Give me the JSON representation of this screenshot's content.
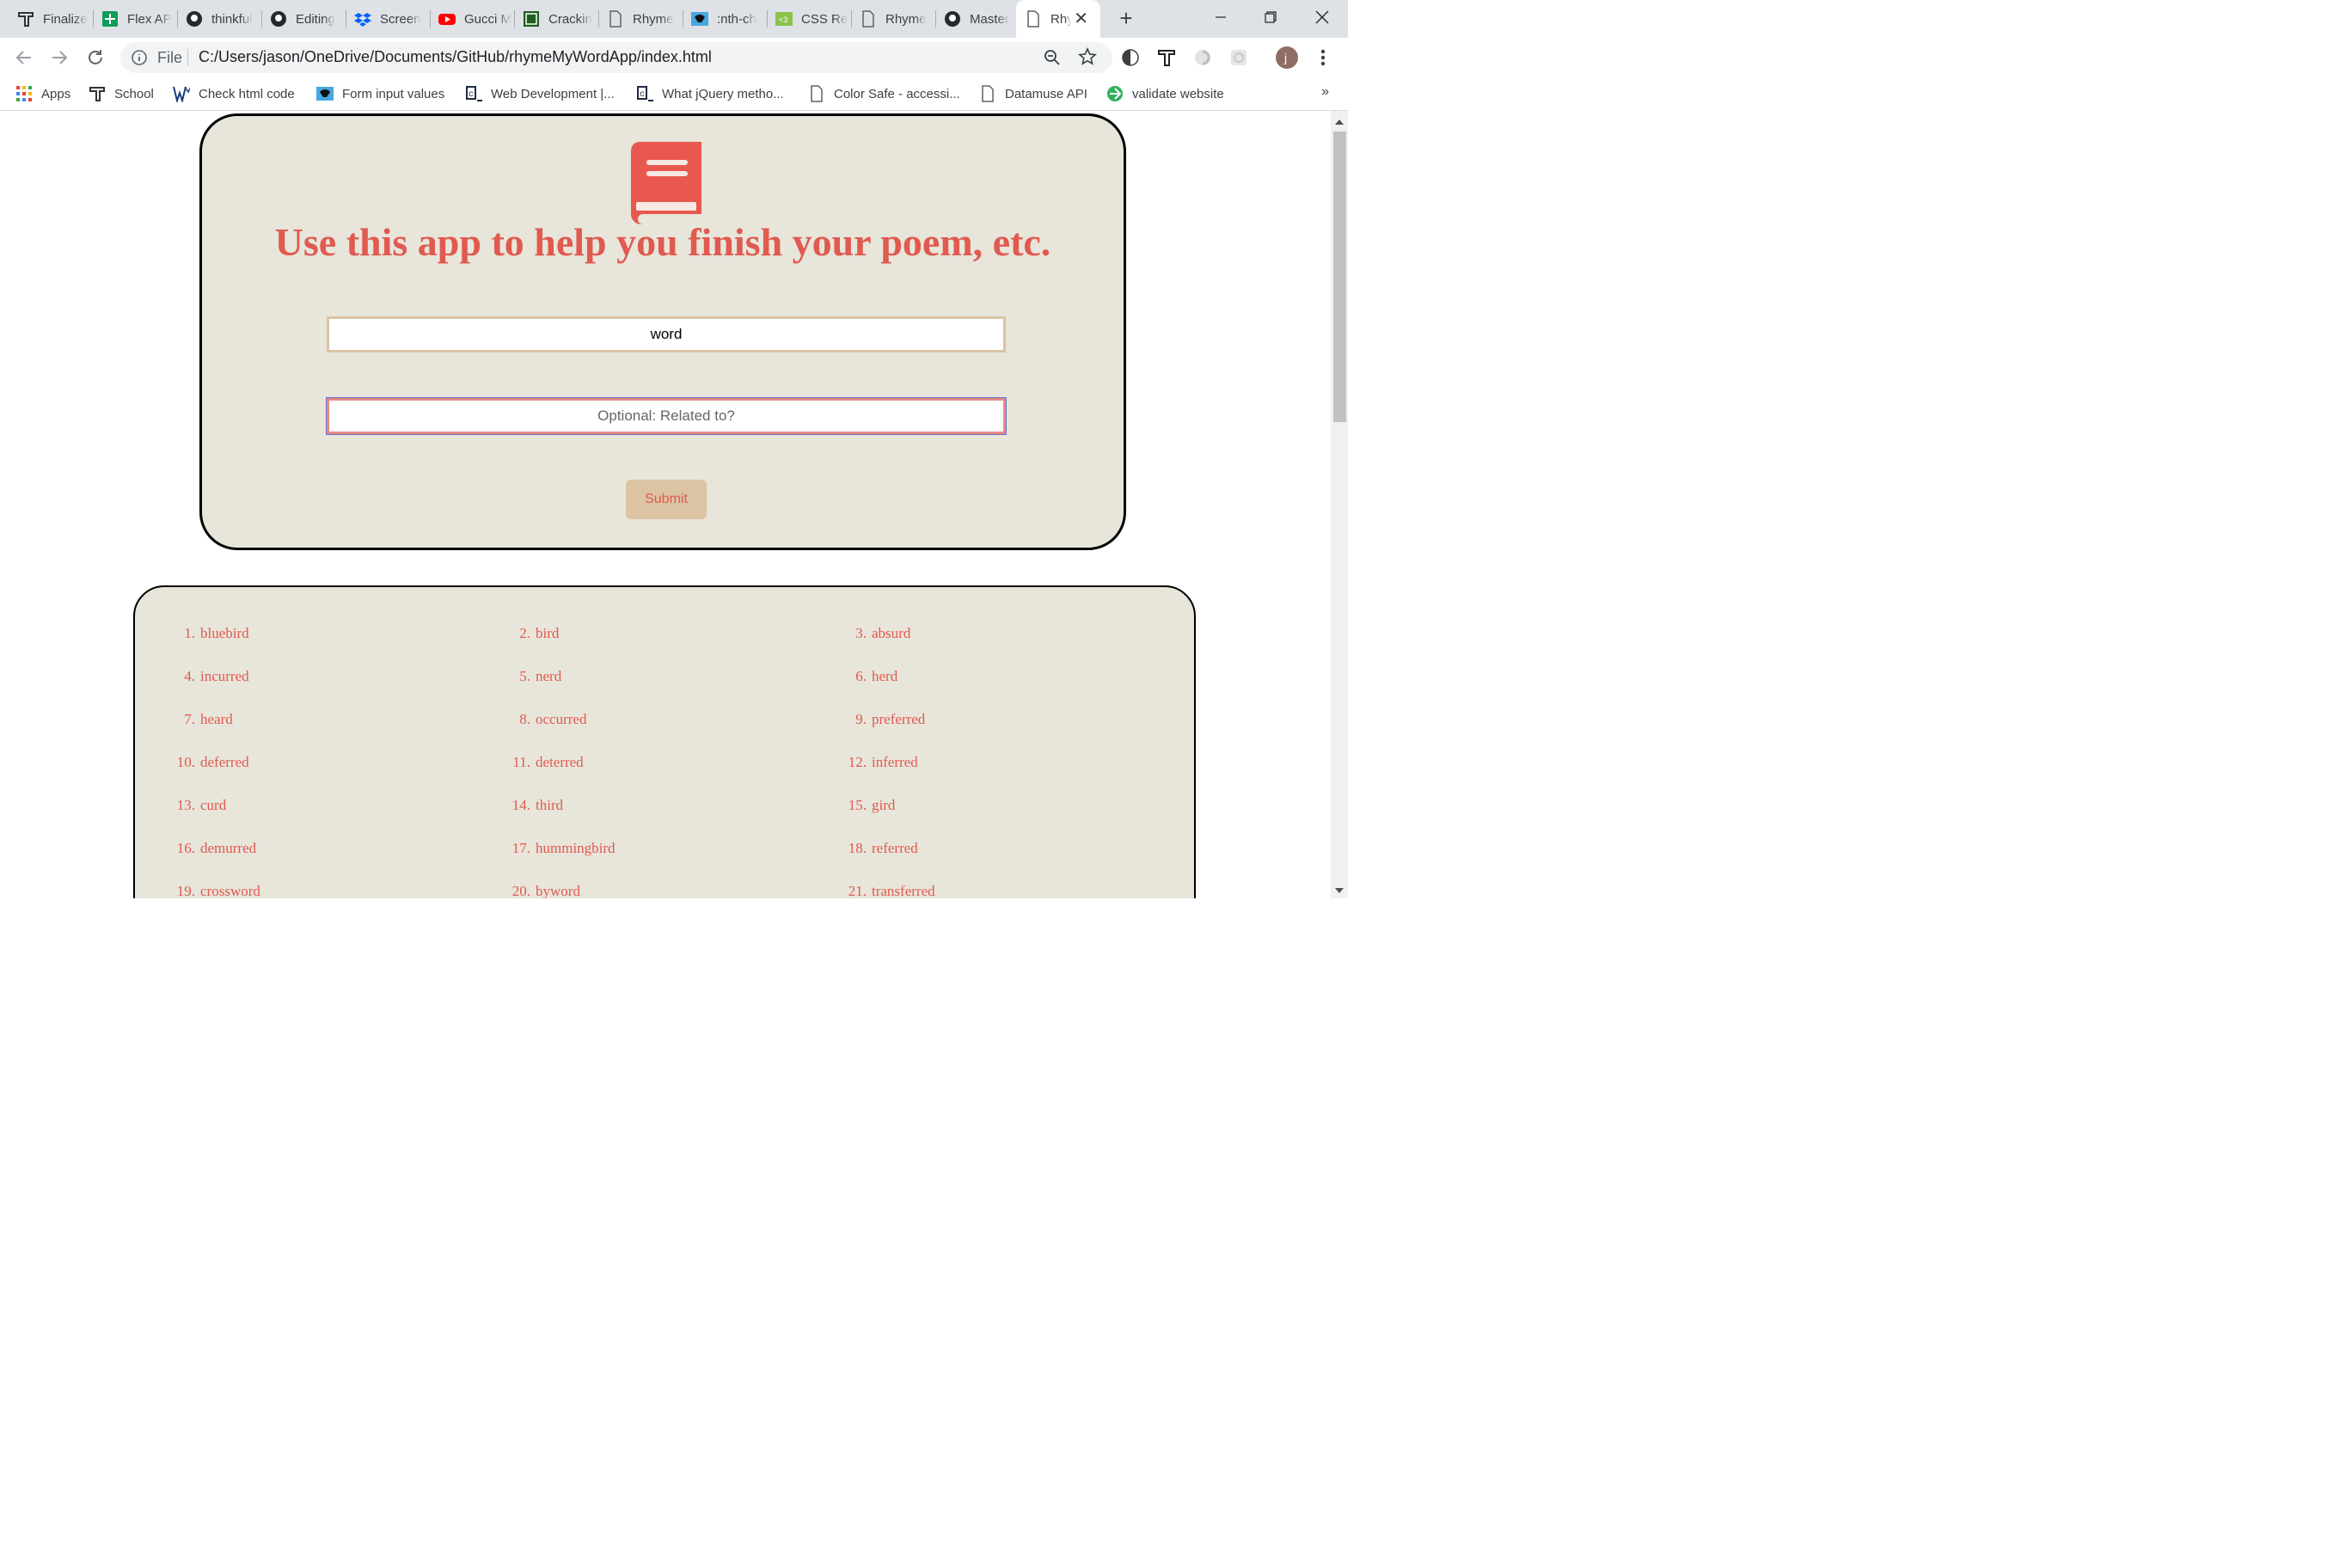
{
  "browser": {
    "tabs": [
      {
        "label": "Finalize",
        "icon": "thinkful-icon"
      },
      {
        "label": "Flex AP",
        "icon": "google-sheets-icon"
      },
      {
        "label": "thinkful",
        "icon": "github-icon"
      },
      {
        "label": "Editing",
        "icon": "github-icon"
      },
      {
        "label": "Screen",
        "icon": "dropbox-icon"
      },
      {
        "label": "Gucci M",
        "icon": "youtube-icon"
      },
      {
        "label": "Crackin",
        "icon": "codepen-icon"
      },
      {
        "label": "Rhyme",
        "icon": "page-icon"
      },
      {
        "label": ":nth-ch",
        "icon": "css-tricks-icon"
      },
      {
        "label": "CSS Re",
        "icon": "css3-icon"
      },
      {
        "label": "Rhyme",
        "icon": "page-icon"
      },
      {
        "label": "Master",
        "icon": "github-icon"
      },
      {
        "label": "Rhy",
        "icon": "page-icon"
      }
    ],
    "omnibox": {
      "scheme_label": "File",
      "url": "C:/Users/jason/OneDrive/Documents/GitHub/rhymeMyWordApp/index.html"
    },
    "profile_initial": "j",
    "bookmarks": [
      {
        "label": "Apps"
      },
      {
        "label": "School"
      },
      {
        "label": "Check html code"
      },
      {
        "label": "Form input values"
      },
      {
        "label": "Web Development |..."
      },
      {
        "label": "What jQuery metho..."
      },
      {
        "label": "Color Safe - accessi..."
      },
      {
        "label": "Datamuse API"
      },
      {
        "label": "validate website"
      }
    ],
    "bookmarks_more": "»"
  },
  "app": {
    "title": "Use this app to help you finish your poem, etc.",
    "word_input": {
      "value": "word"
    },
    "related_input": {
      "placeholder": "Optional: Related to?",
      "value": ""
    },
    "submit_label": "Submit",
    "results": [
      {
        "num": "1.",
        "word": "bluebird"
      },
      {
        "num": "2.",
        "word": "bird"
      },
      {
        "num": "3.",
        "word": "absurd"
      },
      {
        "num": "4.",
        "word": "incurred"
      },
      {
        "num": "5.",
        "word": "nerd"
      },
      {
        "num": "6.",
        "word": "herd"
      },
      {
        "num": "7.",
        "word": "heard"
      },
      {
        "num": "8.",
        "word": "occurred"
      },
      {
        "num": "9.",
        "word": "preferred"
      },
      {
        "num": "10.",
        "word": "deferred"
      },
      {
        "num": "11.",
        "word": "deterred"
      },
      {
        "num": "12.",
        "word": "inferred"
      },
      {
        "num": "13.",
        "word": "curd"
      },
      {
        "num": "14.",
        "word": "third"
      },
      {
        "num": "15.",
        "word": "gird"
      },
      {
        "num": "16.",
        "word": "demurred"
      },
      {
        "num": "17.",
        "word": "hummingbird"
      },
      {
        "num": "18.",
        "word": "referred"
      },
      {
        "num": "19.",
        "word": "crossword"
      },
      {
        "num": "20.",
        "word": "byword"
      },
      {
        "num": "21.",
        "word": "transferred"
      }
    ]
  },
  "colors": {
    "accent": "#e05a50",
    "panel_bg": "#e8e5da",
    "tan": "#dbc3a3"
  }
}
